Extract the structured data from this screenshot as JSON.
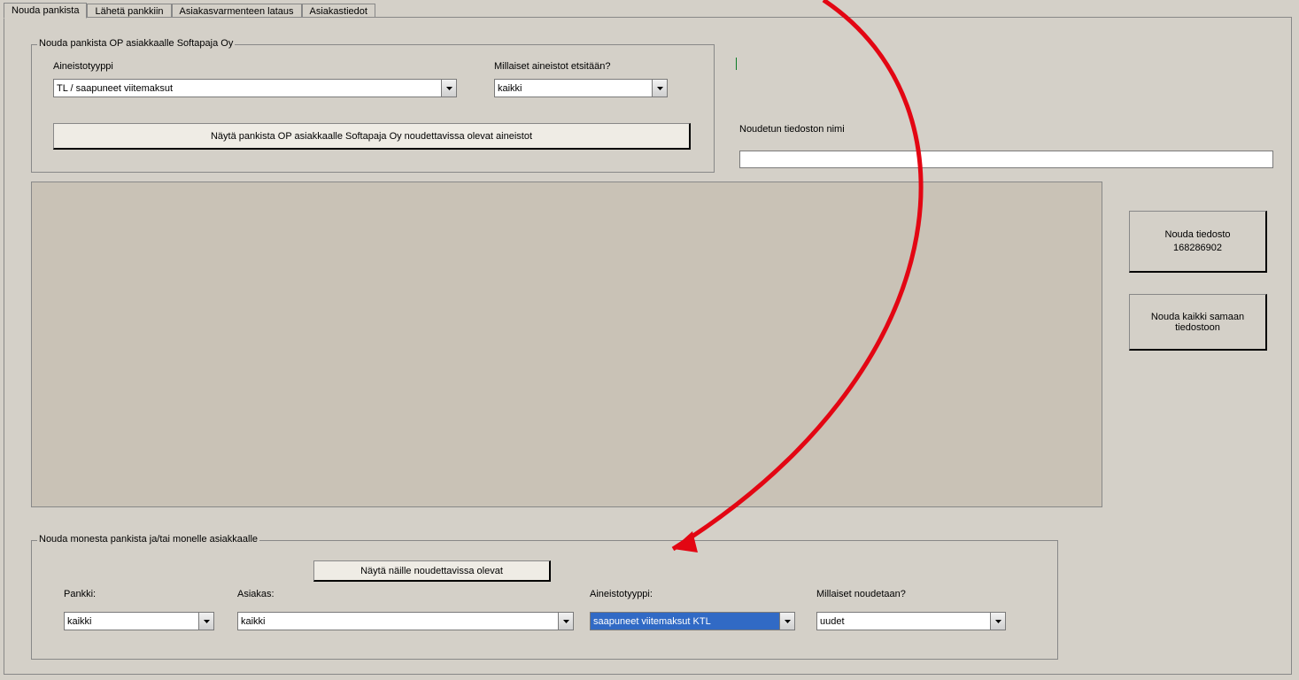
{
  "tabs": [
    {
      "label": "Nouda pankista"
    },
    {
      "label": "Lähetä pankkiin"
    },
    {
      "label": "Asiakasvarmenteen lataus"
    },
    {
      "label": "Asiakastiedot"
    }
  ],
  "top_group": {
    "title": "Nouda pankista OP asiakkaalle Softapaja Oy",
    "aineistotyyppi_label": "Aineistotyyppi",
    "aineistotyyppi_value": "TL / saapuneet viitemaksut",
    "millaiset_label": "Millaiset aineistot etsitään?",
    "millaiset_value": "kaikki",
    "nayta_button": "Näytä pankista OP asiakkaalle Softapaja Oy noudettavissa olevat aineistot"
  },
  "file_name_label": "Noudetun tiedoston nimi",
  "file_name_value": "",
  "side_buttons": {
    "nouda_tiedosto": "Nouda tiedosto\n168286902",
    "nouda_kaikki": "Nouda kaikki samaan tiedostoon"
  },
  "bottom_group": {
    "title": "Nouda monesta pankista ja/tai monelle asiakkaalle",
    "nayta_button": "Näytä näille noudettavissa olevat",
    "pankki_label": "Pankki:",
    "pankki_value": "kaikki",
    "asiakas_label": "Asiakas:",
    "asiakas_value": "kaikki",
    "aineistotyyppi_label": "Aineistotyyppi:",
    "aineistotyyppi_value": "saapuneet viitemaksut KTL",
    "millaiset_label": "Millaiset noudetaan?",
    "millaiset_value": "uudet"
  }
}
